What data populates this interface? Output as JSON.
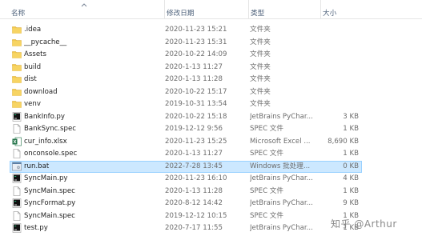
{
  "columns": {
    "name": "名称",
    "date": "修改日期",
    "type": "类型",
    "size": "大小"
  },
  "files": [
    {
      "name": ".idea",
      "date": "2020-11-23 15:21",
      "type": "文件夹",
      "size": "",
      "icon": "folder-icon"
    },
    {
      "name": "__pycache__",
      "date": "2020-11-23 15:31",
      "type": "文件夹",
      "size": "",
      "icon": "folder-icon"
    },
    {
      "name": "Assets",
      "date": "2020-10-22 14:09",
      "type": "文件夹",
      "size": "",
      "icon": "folder-icon"
    },
    {
      "name": "build",
      "date": "2020-1-13 11:27",
      "type": "文件夹",
      "size": "",
      "icon": "folder-icon"
    },
    {
      "name": "dist",
      "date": "2020-1-13 11:28",
      "type": "文件夹",
      "size": "",
      "icon": "folder-icon"
    },
    {
      "name": "download",
      "date": "2020-10-22 15:17",
      "type": "文件夹",
      "size": "",
      "icon": "folder-icon"
    },
    {
      "name": "venv",
      "date": "2019-10-31 13:54",
      "type": "文件夹",
      "size": "",
      "icon": "folder-icon"
    },
    {
      "name": "BankInfo.py",
      "date": "2020-10-22 15:18",
      "type": "JetBrains PyChar...",
      "size": "3 KB",
      "icon": "pycharm-file-icon"
    },
    {
      "name": "BankSync.spec",
      "date": "2019-12-12 9:56",
      "type": "SPEC 文件",
      "size": "1 KB",
      "icon": "blank-file-icon"
    },
    {
      "name": "cur_info.xlsx",
      "date": "2020-11-23 15:25",
      "type": "Microsoft Excel ...",
      "size": "8,690 KB",
      "icon": "excel-file-icon"
    },
    {
      "name": "onconsole.spec",
      "date": "2020-1-13 11:27",
      "type": "SPEC 文件",
      "size": "1 KB",
      "icon": "blank-file-icon"
    },
    {
      "name": "run.bat",
      "date": "2022-7-28 13:45",
      "type": "Windows 批处理...",
      "size": "0 KB",
      "icon": "batch-file-icon",
      "selected": true
    },
    {
      "name": "SyncMain.py",
      "date": "2020-11-23 16:10",
      "type": "JetBrains PyChar...",
      "size": "4 KB",
      "icon": "pycharm-file-icon"
    },
    {
      "name": "SyncMain.spec",
      "date": "2020-1-13 11:28",
      "type": "SPEC 文件",
      "size": "1 KB",
      "icon": "blank-file-icon"
    },
    {
      "name": "SyncFormat.py",
      "date": "2020-8-12 14:42",
      "type": "JetBrains PyChar...",
      "size": "9 KB",
      "icon": "pycharm-file-icon"
    },
    {
      "name": "SyncMain.spec",
      "date": "2019-12-12 10:15",
      "type": "SPEC 文件",
      "size": "1 KB",
      "icon": "blank-file-icon"
    },
    {
      "name": "test.py",
      "date": "2020-7-17 11:55",
      "type": "JetBrains PyChar...",
      "size": "1 KB",
      "icon": "pycharm-file-icon"
    }
  ],
  "watermark": "知乎 @Arthur",
  "colors": {
    "folder": "#f3c94b",
    "selection": "#cce8ff",
    "selection_border": "#99d1ff",
    "excel": "#1d7044"
  }
}
